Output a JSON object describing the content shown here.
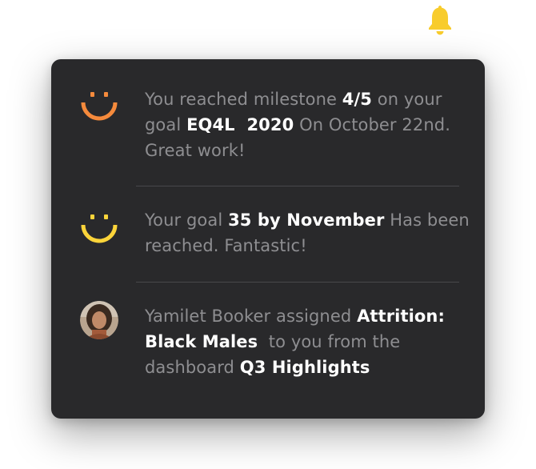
{
  "header": {
    "bell_icon": "bell-icon",
    "bell_color": "#f8cc2c"
  },
  "notifications": [
    {
      "icon": "smiley-icon",
      "icon_color": "#f58a3c",
      "prefix": "You reached milestone ",
      "milestone": "4/5",
      "mid1": " on your goal ",
      "goal": "EQ4L  2020",
      "suffix": " On October 22nd. Great work!"
    },
    {
      "icon": "smiley-icon",
      "icon_color": "#fbd43a",
      "prefix": "Your goal ",
      "goal": "35 by November",
      "suffix": " Has been reached. Fantastic!"
    },
    {
      "icon": "avatar",
      "user": "Yamilet Booker",
      "action": " assigned ",
      "item": "Attrition: Black Males",
      "mid": "  to you from the dashboard ",
      "dashboard": "Q3 Highlights"
    }
  ],
  "colors": {
    "panel_bg": "#29292b",
    "muted_text": "#8e8e91",
    "bold_text": "#ffffff"
  }
}
